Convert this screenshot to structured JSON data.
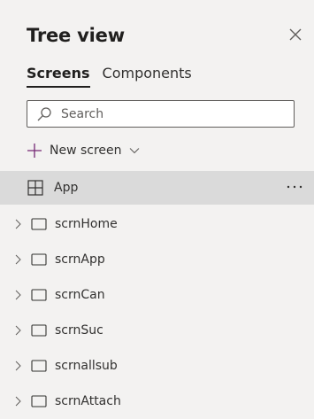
{
  "panel": {
    "title": "Tree view",
    "close_icon": "close-icon"
  },
  "tabs": [
    {
      "label": "Screens",
      "active": true
    },
    {
      "label": "Components",
      "active": false
    }
  ],
  "search": {
    "placeholder": "Search",
    "icon": "search-icon"
  },
  "new_screen": {
    "label": "New screen",
    "icon": "plus-icon",
    "dropdown_icon": "chevron-down-icon"
  },
  "app_node": {
    "label": "App",
    "icon": "app-icon",
    "more_label": "···",
    "selected": true
  },
  "screens": [
    {
      "label": "scrnHome"
    },
    {
      "label": "scrnApp"
    },
    {
      "label": "scrnCan"
    },
    {
      "label": "scrnSuc"
    },
    {
      "label": "scrnallsub"
    },
    {
      "label": "scrnAttach"
    }
  ],
  "colors": {
    "background": "#f3f2f1",
    "selected_row": "#dadada",
    "accent": "#742774",
    "text": "#323130"
  }
}
